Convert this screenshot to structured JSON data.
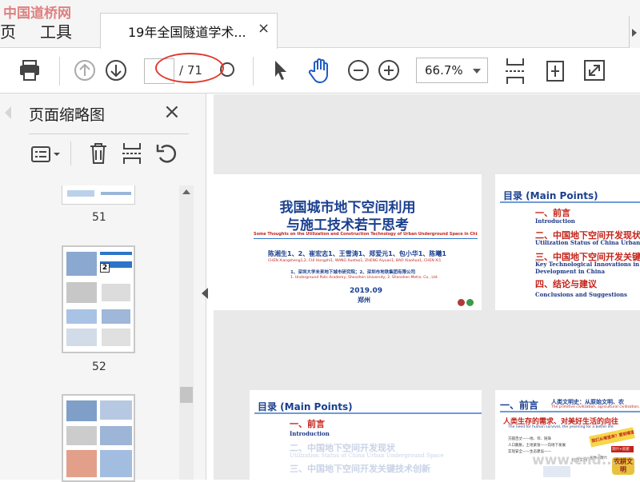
{
  "menu": {
    "partial": "页",
    "tools": "工具"
  },
  "tab": {
    "title": "19年全国隧道学术...",
    "close": "×"
  },
  "watermark_top": "中国道桥网",
  "watermark_bottom": "www.cnd...",
  "toolbar": {
    "page_current": "",
    "page_total": "/ 71",
    "zoom": "66.7%"
  },
  "panel": {
    "title": "页面缩略图",
    "close": "×",
    "thumbs": [
      {
        "page": "51"
      },
      {
        "page": "52"
      }
    ]
  },
  "slide1": {
    "title1": "我国城市地下空间利用",
    "title2": "与施工技术若干思考",
    "subtitle": "Some Thoughts on the Utilization and Construction Technology of Urban Underground Space in China",
    "authors": "陈湘生1、2、崔宏志1、王雪涛1、郑爱元1、包小华1、陈曦1",
    "authors_en": "CHEN Xiangsheng1,2, CUI Hongzhi1, WANG Xuetao1, ZHENG Aiyuan1, BAO Xiaohua1, CHEN Xi1",
    "affil": "1、深圳大学未来地下城市研究院；2、深圳市地铁集团有限公司",
    "affil_en": "1. Underground Polis Academy, Shenzhen University; 2. Shenzhen Metro. Co., Ltd.",
    "date": "2019.09",
    "place": "郑州"
  },
  "slide2": {
    "header": "目录 (Main Points)",
    "items": [
      {
        "cn": "一、前言",
        "en": "Introduction"
      },
      {
        "cn": "二、中国地下空间开发现状",
        "en": "Utilization Status of China Urban U"
      },
      {
        "cn": "三、中国地下空间开发关键",
        "en": "Key Technological Innovations in Urba"
      },
      {
        "cn": "",
        "en": "Development in China"
      },
      {
        "cn": "四、结论与建议",
        "en": "Conclusions and Suggestions"
      }
    ]
  },
  "slide3": {
    "header": "目录 (Main Points)",
    "items": [
      {
        "cn": "一、前言",
        "en": "Introduction"
      },
      {
        "cn": "二、中国地下空间开发现状",
        "en": "Utilization Status of China Urban Underground Space"
      },
      {
        "cn": "三、中国地下空间开发关键技术创新",
        "en": ""
      }
    ]
  },
  "slide4": {
    "header": "一、前言",
    "hist": "人类文明史：从原始文明、农",
    "hist_en": "The primitive civilization, agricultural civilization,",
    "title": "人类生存的需求、对美好生活的向往",
    "title_en": "The need for human survival, the yearning for a better life",
    "lines": [
      "方圆百丈——地、邻、链珠",
      "人口膨胀，土地紧张——向地下发展",
      "实现安全——生态建设——"
    ],
    "badge": "我们从哪里来？要到哪里去？",
    "tags": [
      "洞穴+房屋",
      "丛林+洞穴"
    ],
    "food": "农耕文明",
    "map_label": "北地文明"
  },
  "colors": {
    "accent": "#1a3f8f",
    "annotation": "#e03a2e",
    "title_red": "#c4231a"
  }
}
